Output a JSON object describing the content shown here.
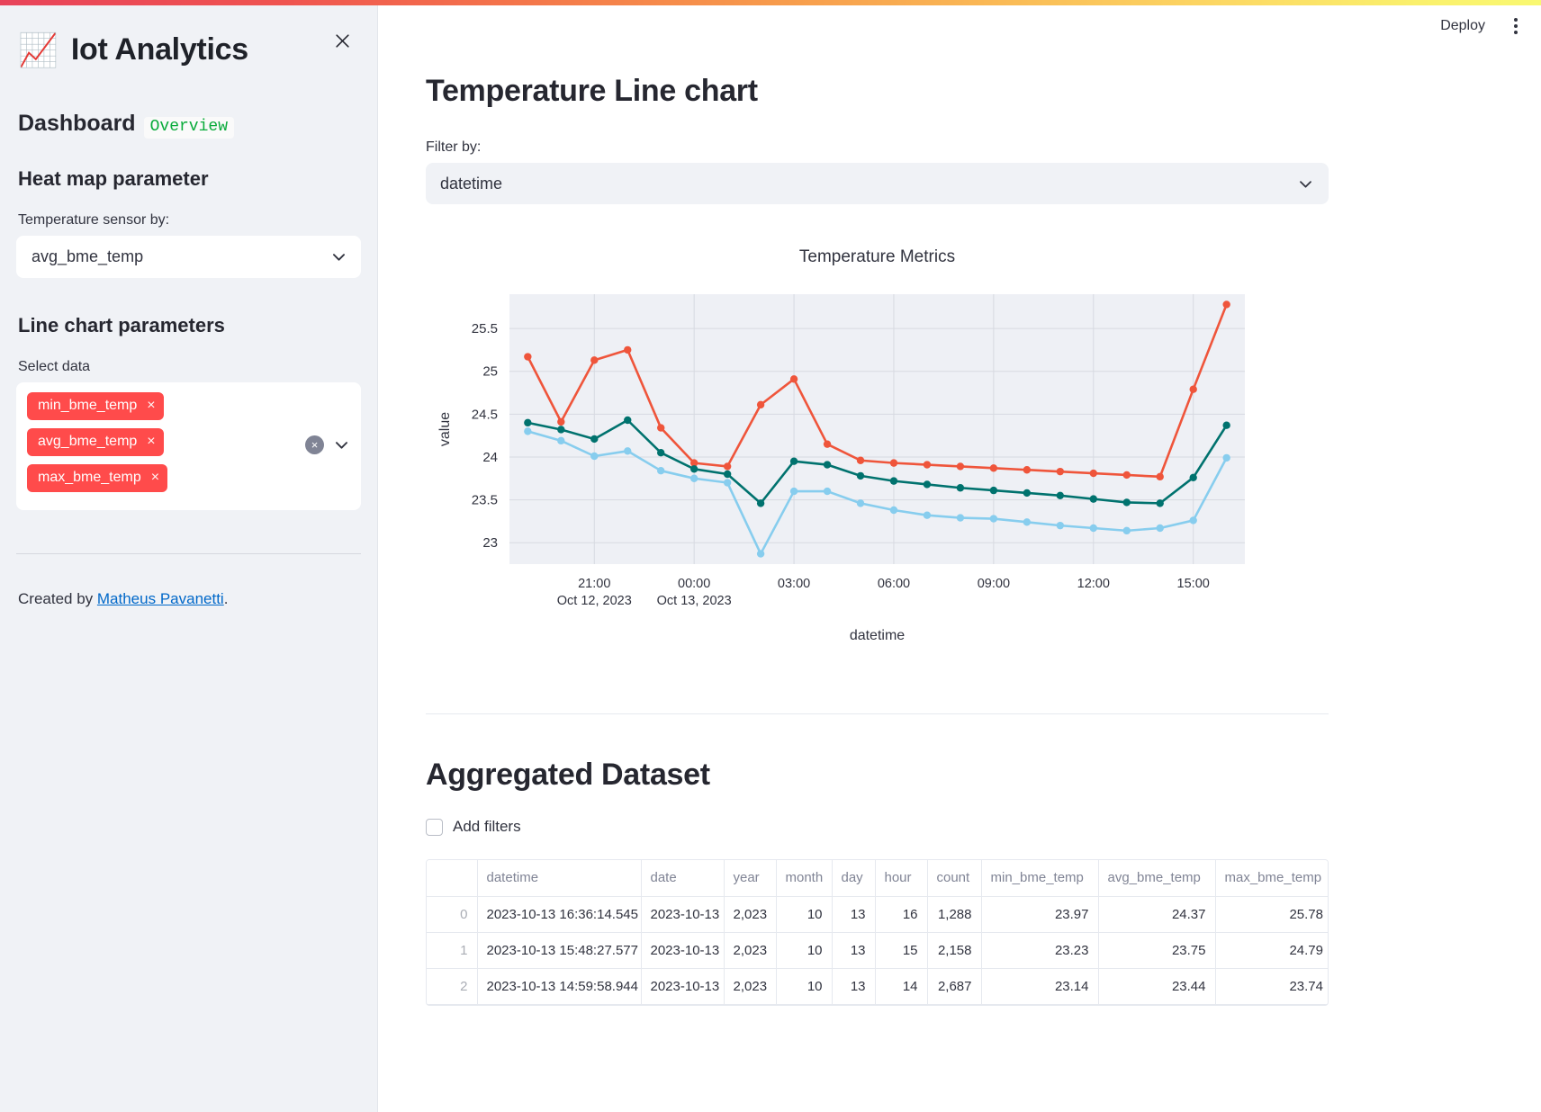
{
  "theme": {
    "accent_red": "#ff4b4b",
    "series_max": "#ef553b",
    "series_avg": "#00726e",
    "series_min": "#87cdee",
    "sidebar_bg": "#f0f2f6",
    "link": "#0068c9",
    "code_green": "#09ab3b"
  },
  "sidebar": {
    "close_icon": "close-icon",
    "brand_icon": "chart-monitor-icon",
    "brand_title": "Iot Analytics",
    "dashboard_label": "Dashboard",
    "dashboard_badge": "Overview",
    "heat_map_heading": "Heat map parameter",
    "temperature_sensor_label": "Temperature sensor by:",
    "temperature_sensor_value": "avg_bme_temp",
    "line_chart_heading": "Line chart parameters",
    "select_data_label": "Select data",
    "selected_tags": [
      "min_bme_temp",
      "avg_bme_temp",
      "max_bme_temp"
    ],
    "tag_remove_glyph": "×",
    "clear_all_glyph": "×",
    "credit_prefix": "Created by ",
    "credit_link": "Matheus Pavanetti",
    "credit_suffix": "."
  },
  "topbar": {
    "deploy_label": "Deploy",
    "menu_icon": "kebab-menu-icon"
  },
  "main": {
    "page_title": "Temperature Line chart",
    "filter_label": "Filter by:",
    "filter_value": "datetime",
    "section_title": "Aggregated Dataset",
    "add_filters_label": "Add filters",
    "add_filters_checked": false
  },
  "chart_data": {
    "type": "line",
    "title": "Temperature Metrics",
    "xlabel": "datetime",
    "ylabel": "value",
    "ylim": [
      22.75,
      25.9
    ],
    "yticks": [
      23,
      23.5,
      24,
      24.5,
      25,
      25.5
    ],
    "xticks": [
      {
        "label": "21:00",
        "sublabel": "Oct 12, 2023"
      },
      {
        "label": "00:00",
        "sublabel": "Oct 13, 2023"
      },
      {
        "label": "03:00",
        "sublabel": ""
      },
      {
        "label": "06:00",
        "sublabel": ""
      },
      {
        "label": "09:00",
        "sublabel": ""
      },
      {
        "label": "12:00",
        "sublabel": ""
      },
      {
        "label": "15:00",
        "sublabel": ""
      }
    ],
    "x": [
      "19:00",
      "20:00",
      "21:00",
      "22:00",
      "23:00",
      "00:00",
      "01:00",
      "02:00",
      "03:00",
      "04:00",
      "05:00",
      "06:00",
      "07:00",
      "08:00",
      "09:00",
      "10:00",
      "11:00",
      "12:00",
      "13:00",
      "14:00",
      "15:00",
      "16:00"
    ],
    "grid": true,
    "legend": "none",
    "series": [
      {
        "name": "max_bme_temp",
        "color": "#ef553b",
        "values": [
          25.17,
          24.41,
          25.13,
          25.25,
          24.34,
          23.93,
          23.89,
          24.61,
          24.91,
          24.15,
          23.96,
          23.93,
          23.91,
          23.89,
          23.87,
          23.85,
          23.83,
          23.81,
          23.79,
          23.77,
          24.79,
          25.78
        ]
      },
      {
        "name": "avg_bme_temp",
        "color": "#00726e",
        "values": [
          24.4,
          24.32,
          24.21,
          24.43,
          24.05,
          23.86,
          23.8,
          23.46,
          23.95,
          23.91,
          23.78,
          23.72,
          23.68,
          23.64,
          23.61,
          23.58,
          23.55,
          23.51,
          23.47,
          23.46,
          23.76,
          24.37
        ]
      },
      {
        "name": "min_bme_temp",
        "color": "#87cdee",
        "values": [
          24.3,
          24.19,
          24.01,
          24.07,
          23.84,
          23.75,
          23.7,
          22.87,
          23.6,
          23.6,
          23.46,
          23.38,
          23.32,
          23.29,
          23.28,
          23.24,
          23.2,
          23.17,
          23.14,
          23.17,
          23.26,
          23.99
        ]
      }
    ]
  },
  "table": {
    "columns": [
      "",
      "datetime",
      "date",
      "year",
      "month",
      "day",
      "hour",
      "count",
      "min_bme_temp",
      "avg_bme_temp",
      "max_bme_temp"
    ],
    "rows": [
      {
        "index": "0",
        "datetime": "2023-10-13 16:36:14.545",
        "date": "2023-10-13",
        "year": "2,023",
        "month": "10",
        "day": "13",
        "hour": "16",
        "count": "1,288",
        "min_bme_temp": "23.97",
        "avg_bme_temp": "24.37",
        "max_bme_temp": "25.78"
      },
      {
        "index": "1",
        "datetime": "2023-10-13 15:48:27.577",
        "date": "2023-10-13",
        "year": "2,023",
        "month": "10",
        "day": "13",
        "hour": "15",
        "count": "2,158",
        "min_bme_temp": "23.23",
        "avg_bme_temp": "23.75",
        "max_bme_temp": "24.79"
      },
      {
        "index": "2",
        "datetime": "2023-10-13 14:59:58.944",
        "date": "2023-10-13",
        "year": "2,023",
        "month": "10",
        "day": "13",
        "hour": "14",
        "count": "2,687",
        "min_bme_temp": "23.14",
        "avg_bme_temp": "23.44",
        "max_bme_temp": "23.74"
      }
    ]
  }
}
